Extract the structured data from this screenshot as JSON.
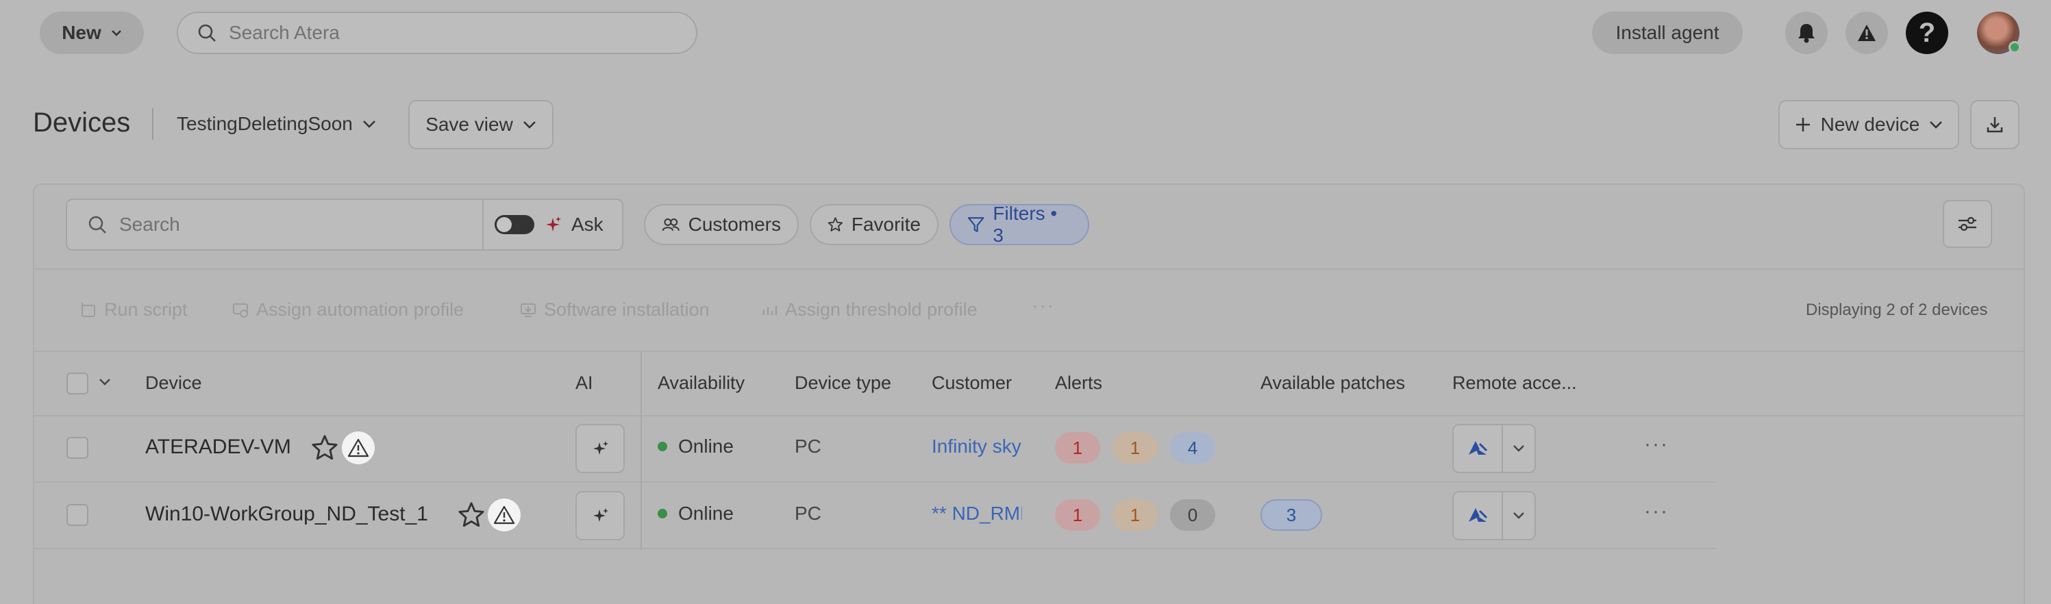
{
  "topbar": {
    "new_label": "New",
    "search_placeholder": "Search Atera",
    "install_agent_label": "Install agent",
    "help_label": "?"
  },
  "header": {
    "title": "Devices",
    "view_name": "TestingDeletingSoon",
    "save_view_label": "Save view",
    "new_device_label": "New device"
  },
  "toolbar": {
    "search_placeholder": "Search",
    "ask_label": "Ask",
    "customers_label": "Customers",
    "favorite_label": "Favorite",
    "filters_label": "Filters • 3"
  },
  "bulk_actions": {
    "run_script": "Run script",
    "assign_automation": "Assign automation profile",
    "software_installation": "Software installation",
    "assign_threshold": "Assign threshold profile",
    "more": "···",
    "display_count": "Displaying 2 of 2 devices"
  },
  "table": {
    "headers": {
      "device": "Device",
      "ai": "AI",
      "availability": "Availability",
      "device_type": "Device type",
      "customer": "Customer",
      "alerts": "Alerts",
      "patches": "Available patches",
      "remote": "Remote acce..."
    },
    "rows": [
      {
        "device": "ATERADEV-VM",
        "availability": "Online",
        "device_type": "PC",
        "customer": "Infinity sky",
        "alerts": [
          "1",
          "1",
          "4"
        ],
        "patches": "",
        "more": "···"
      },
      {
        "device": "Win10-WorkGroup_ND_Test_1",
        "availability": "Online",
        "device_type": "PC",
        "customer": "** ND_RMM",
        "alerts": [
          "1",
          "1",
          "0"
        ],
        "patches": "3",
        "more": "···"
      }
    ]
  },
  "colors": {
    "background": "#b9b9b9",
    "accent": "#2c4a93",
    "online": "#3a8f4a",
    "alert_red": "#b0262b",
    "alert_orange": "#a0561a"
  },
  "icons": {
    "search": "search-icon",
    "bell": "bell-icon",
    "warning": "warning-icon",
    "help": "help-icon",
    "chevron": "chevron-down-icon",
    "star": "star-icon",
    "sparkle": "sparkle-icon",
    "filter": "filter-icon",
    "remote": "remote-access-icon",
    "export": "download-icon",
    "settings": "sliders-icon"
  }
}
